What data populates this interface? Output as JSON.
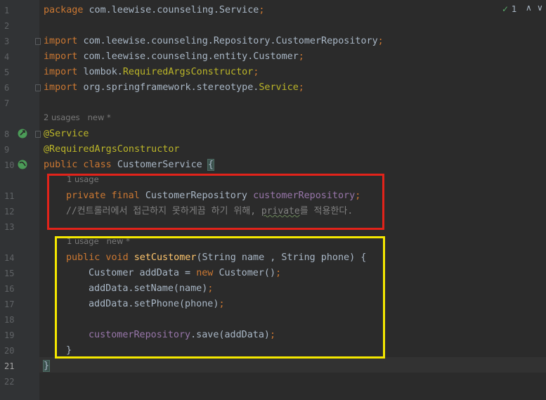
{
  "status": {
    "check_count": "1",
    "check_icon": "check-icon",
    "up": "∧",
    "down": "∨"
  },
  "lines": {
    "l1": {
      "num": "1",
      "t1": "package ",
      "t2": "com.leewise.counseling.Service",
      "t3": ";"
    },
    "l2": {
      "num": "2"
    },
    "l3": {
      "num": "3",
      "t1": "import ",
      "t2": "com.leewise.counseling.Repository.CustomerRepository",
      "t3": ";"
    },
    "l4": {
      "num": "4",
      "t1": "import ",
      "t2": "com.leewise.counseling.entity.Customer",
      "t3": ";"
    },
    "l5": {
      "num": "5",
      "t1": "import ",
      "t2": "lombok.",
      "t3": "RequiredArgsConstructor",
      "t4": ";"
    },
    "l6": {
      "num": "6",
      "t1": "import ",
      "t2": "org.springframework.stereotype.",
      "t3": "Service",
      "t4": ";"
    },
    "l7": {
      "num": "7"
    },
    "hint_class": "2 usages   new *",
    "l8": {
      "num": "8",
      "t1": "@Service"
    },
    "l9": {
      "num": "9",
      "t1": "@RequiredArgsConstructor"
    },
    "l10": {
      "num": "10",
      "t1": "public class ",
      "t2": "CustomerService ",
      "t3": "{"
    },
    "hint_field": "1 usage",
    "l11": {
      "num": "11",
      "t1": "private final ",
      "t2": "CustomerRepository ",
      "t3": "customerRepository",
      "t4": ";"
    },
    "l12": {
      "num": "12",
      "t1": "//컨트롤러에서 접근하지 못하게끔 하기 위해, ",
      "t2": "private",
      "t3": "를 적용한다."
    },
    "l13": {
      "num": "13"
    },
    "hint_method": "1 usage   new *",
    "l14": {
      "num": "14",
      "t1": "public void ",
      "t2": "setCustomer",
      "t3": "(String name , String phone) {"
    },
    "l15": {
      "num": "15",
      "t1": "Customer addData = ",
      "t2": "new ",
      "t3": "Customer()",
      "t4": ";"
    },
    "l16": {
      "num": "16",
      "t1": "addData.setName(name)",
      "t2": ";"
    },
    "l17": {
      "num": "17",
      "t1": "addData.setPhone(phone)",
      "t2": ";"
    },
    "l18": {
      "num": "18"
    },
    "l19": {
      "num": "19",
      "t1": "customerRepository",
      "t2": ".save(addData)",
      "t3": ";"
    },
    "l20": {
      "num": "20",
      "t1": "}"
    },
    "l21": {
      "num": "21",
      "t1": "}"
    },
    "l22": {
      "num": "22"
    }
  },
  "colors": {
    "keyword": "#cc7832",
    "annotation": "#bbb529",
    "field": "#9876aa",
    "method": "#ffc66d",
    "comment": "#808080",
    "red_box": "#e2231a",
    "yellow_box": "#f5e800"
  },
  "gutter_icons": {
    "l8": "spring-bean-icon",
    "l10": "spring-bean-icon"
  }
}
